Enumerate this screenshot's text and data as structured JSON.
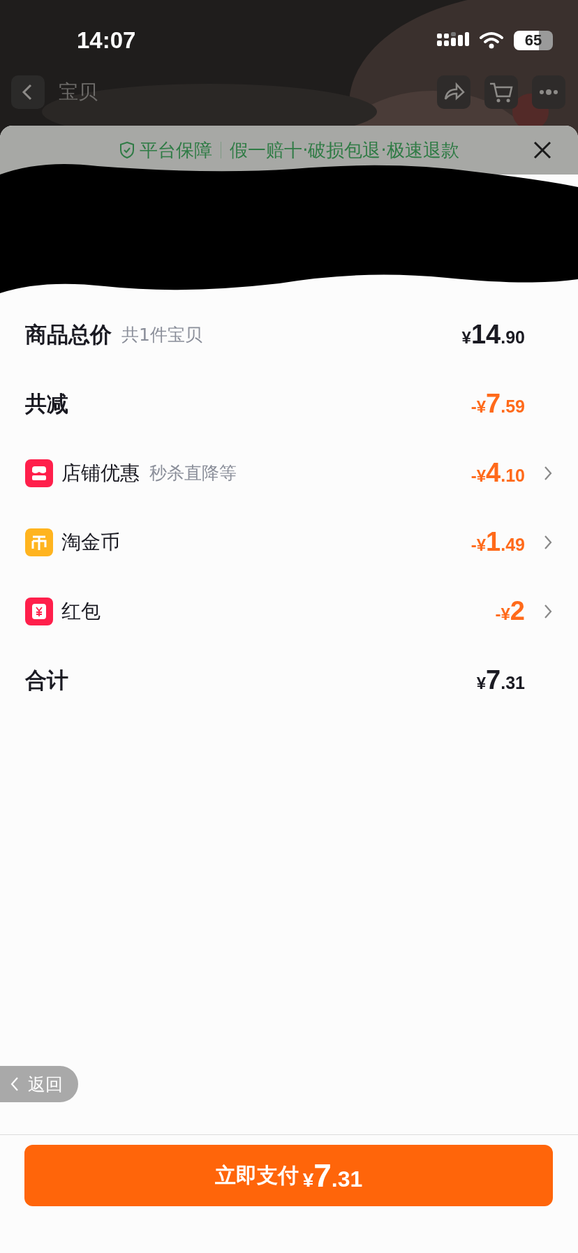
{
  "status_bar": {
    "time": "14:07",
    "battery": "65"
  },
  "background_nav": {
    "tab": "宝贝"
  },
  "sheet": {
    "banner": {
      "title": "平台保障",
      "text": "假一赔十·破损包退·极速退款"
    },
    "rows": [
      {
        "kind": "subtotal",
        "label": "商品总价",
        "note": "共1件宝贝",
        "amount": "¥14.90"
      },
      {
        "kind": "reduction",
        "label": "共减",
        "amount": "-¥7.59"
      },
      {
        "kind": "shop",
        "label": "店铺优惠",
        "note": "秒杀直降等",
        "amount": "-¥4.10"
      },
      {
        "kind": "coin",
        "label": "淘金币",
        "amount": "-¥1.49"
      },
      {
        "kind": "packet",
        "label": "红包",
        "amount": "-¥2"
      },
      {
        "kind": "total",
        "label": "合计",
        "amount": "¥7.31"
      }
    ]
  },
  "back_pill": {
    "label": "返回"
  },
  "pay_button": {
    "label": "立即支付",
    "amount": "¥7.31"
  }
}
